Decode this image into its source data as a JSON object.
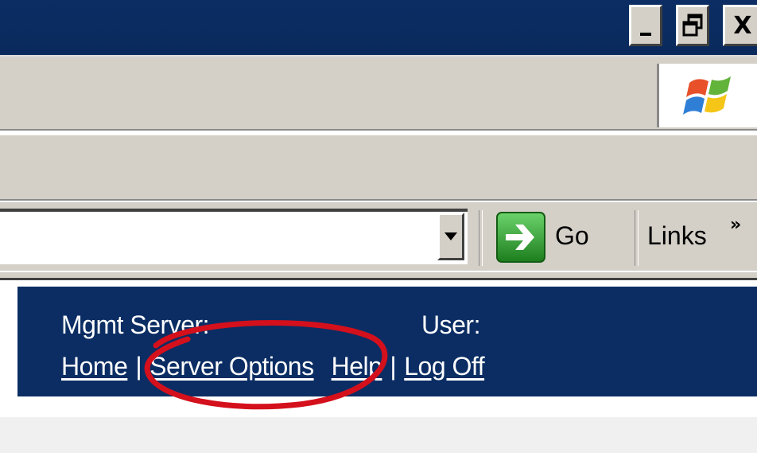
{
  "window": {
    "controls": {
      "minimize_icon": "minimize-icon",
      "restore_icon": "restore-icon",
      "close_label": "X"
    }
  },
  "toolbar": {
    "go_label": "Go",
    "links_label": "Links",
    "more_label": "»"
  },
  "banner": {
    "mgmt_server_label": "Mgmt Server:",
    "user_label": "User:",
    "nav": {
      "home": "Home",
      "server_options": "Server Options",
      "help": "Help",
      "log_off": "Log Off",
      "separator": "|"
    }
  },
  "colors": {
    "titlebar": "#0b2d63",
    "chrome": "#d4d0c8",
    "banner": "#0b2d63",
    "highlight_circle": "#d4101c",
    "go_green": "#2e9b2e"
  }
}
